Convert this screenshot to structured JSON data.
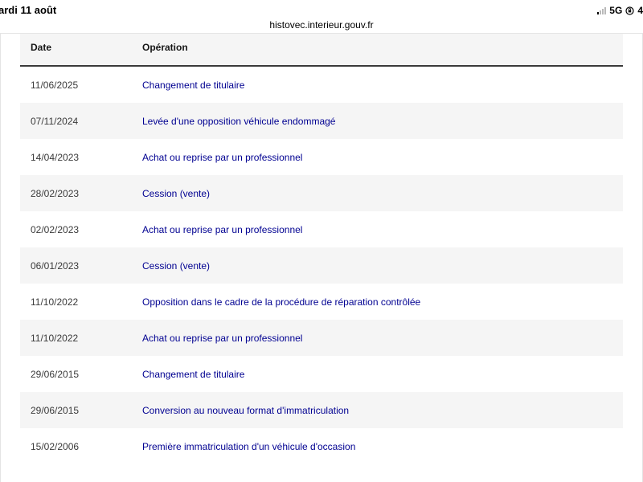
{
  "status_bar": {
    "time": "ardi 11 août",
    "network": "5G",
    "battery": "4"
  },
  "browser": {
    "url": "histovec.interieur.gouv.fr"
  },
  "table": {
    "headers": {
      "date": "Date",
      "operation": "Opération"
    },
    "rows": [
      {
        "date": "11/06/2025",
        "operation": "Changement de titulaire"
      },
      {
        "date": "07/11/2024",
        "operation": "Levée d'une opposition véhicule endommagé"
      },
      {
        "date": "14/04/2023",
        "operation": "Achat ou reprise par un professionnel"
      },
      {
        "date": "28/02/2023",
        "operation": "Cession (vente)"
      },
      {
        "date": "02/02/2023",
        "operation": "Achat ou reprise par un professionnel"
      },
      {
        "date": "06/01/2023",
        "operation": "Cession (vente)"
      },
      {
        "date": "11/10/2022",
        "operation": "Opposition dans le cadre de la procédure de réparation contrôlée"
      },
      {
        "date": "11/10/2022",
        "operation": "Achat ou reprise par un professionnel"
      },
      {
        "date": "29/06/2015",
        "operation": "Changement de titulaire"
      },
      {
        "date": "29/06/2015",
        "operation": "Conversion au nouveau format d'immatriculation"
      },
      {
        "date": "15/02/2006",
        "operation": "Première immatriculation d'un véhicule d'occasion"
      }
    ]
  },
  "colors": {
    "link": "#000091",
    "row_alt": "#f5f5f5",
    "header_rule": "#3a3a3a"
  }
}
